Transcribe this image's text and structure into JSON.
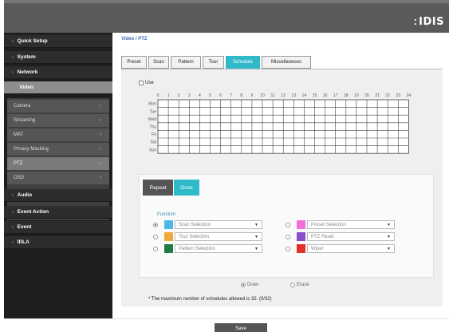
{
  "header": {
    "logo_text": "IDIS",
    "logo_mark": "⁚"
  },
  "sidebar": {
    "items": [
      {
        "label": "Quick Setup"
      },
      {
        "label": "System"
      },
      {
        "label": "Network"
      },
      {
        "label": "Video"
      },
      {
        "label": "Audio"
      },
      {
        "label": "Event Action"
      },
      {
        "label": "Event"
      },
      {
        "label": "IDLA"
      }
    ],
    "video_sub": [
      {
        "label": "Camera"
      },
      {
        "label": "Streaming"
      },
      {
        "label": "MAT"
      },
      {
        "label": "Privacy Masking"
      },
      {
        "label": "PTZ"
      },
      {
        "label": "OSD"
      }
    ]
  },
  "main": {
    "breadcrumb": "Video / PTZ",
    "tabs": [
      {
        "label": "Preset"
      },
      {
        "label": "Scan"
      },
      {
        "label": "Pattern"
      },
      {
        "label": "Tour"
      },
      {
        "label": "Schedule"
      },
      {
        "label": "Miscellaneous"
      }
    ],
    "active_tab": "Schedule",
    "use_label": "Use",
    "use_checked": false,
    "schedule": {
      "days": [
        "Mon",
        "Tue",
        "Wed",
        "Thu",
        "Fri",
        "Sat",
        "Sun"
      ],
      "hours": [
        "0",
        "1",
        "2",
        "3",
        "4",
        "5",
        "6",
        "7",
        "8",
        "9",
        "10",
        "11",
        "12",
        "13",
        "14",
        "15",
        "16",
        "17",
        "18",
        "19",
        "20",
        "21",
        "22",
        "23",
        "24"
      ]
    },
    "mode": {
      "repeat_label": "Repeat",
      "once_label": "Once",
      "active": "Once"
    },
    "functions_label": "Function",
    "functions": [
      {
        "label": "Scan Selection",
        "color": "#4bb8e6",
        "selected": true
      },
      {
        "label": "Tour Selection",
        "color": "#f0a73c",
        "selected": false
      },
      {
        "label": "Pattern Selection",
        "color": "#1f7a46",
        "selected": false
      },
      {
        "label": "Preset Selection",
        "color": "#f06fd8",
        "selected": false
      },
      {
        "label": "PTZ Reset",
        "color": "#8a4fc8",
        "selected": false
      },
      {
        "label": "Wiper",
        "color": "#e63028",
        "selected": false
      }
    ],
    "draw_label": "Draw",
    "erase_label": "Erase",
    "draw_selected": true,
    "note": "* The maximum number of schedules allowed is 32. (0/32)"
  },
  "footer": {
    "save_label": "Save"
  },
  "colors": {
    "accent": "#2fb9c9",
    "sidebar_bg": "#1e1e1e",
    "header_bg": "#5a5a5a"
  }
}
